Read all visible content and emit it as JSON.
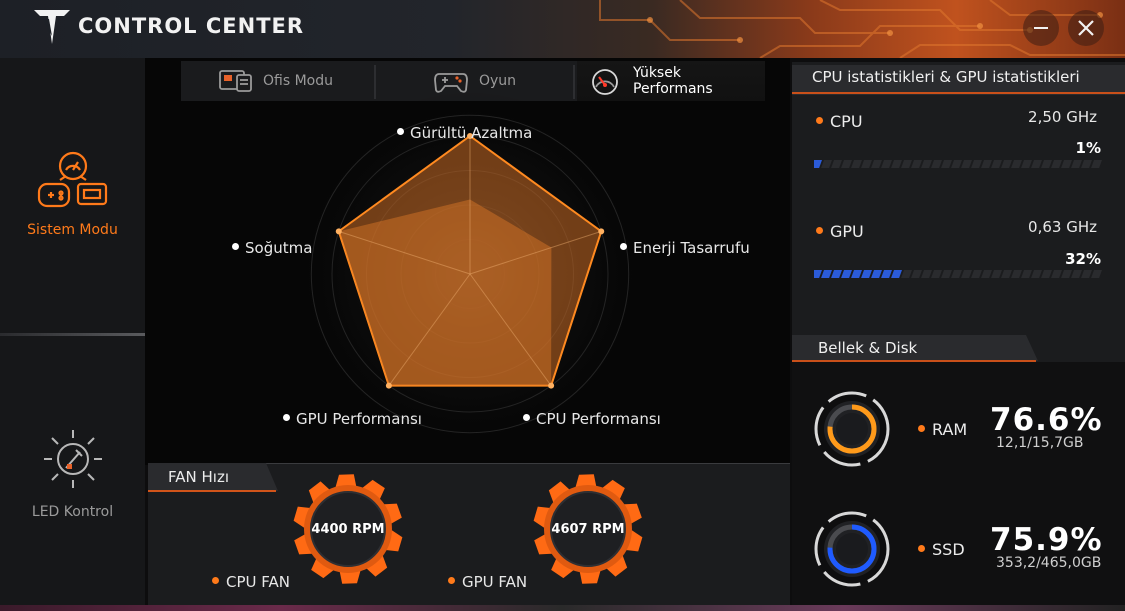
{
  "window": {
    "title": "CONTROL CENTER",
    "accent": "#ff7a1a"
  },
  "sidebar": {
    "items": [
      {
        "label": "Sistem Modu",
        "icon": "system-mode-icon",
        "active": true
      },
      {
        "label": "LED Kontrol",
        "icon": "led-control-icon",
        "active": false
      }
    ]
  },
  "modes": {
    "tabs": [
      {
        "label": "Ofis Modu",
        "icon": "office-icon",
        "active": false
      },
      {
        "label": "Oyun",
        "icon": "gamepad-icon",
        "active": false
      },
      {
        "label": "Yüksek Performans",
        "icon": "speedometer-icon",
        "active": true
      }
    ]
  },
  "radar": {
    "axes": [
      "Gürültü Azaltma",
      "Enerji Tasarrufu",
      "CPU Performansı",
      "GPU Performansı",
      "Soğutma"
    ],
    "profile_values": [
      1.0,
      1.0,
      1.0,
      1.0,
      1.0
    ],
    "inner_values": [
      0.54,
      0.62,
      1.0,
      1.0,
      1.0
    ]
  },
  "fans": {
    "title": "FAN Hızı",
    "items": [
      {
        "label": "CPU FAN",
        "rpm": "4400 RPM"
      },
      {
        "label": "GPU FAN",
        "rpm": "4607 RPM"
      }
    ]
  },
  "stats": {
    "title": "CPU istatistikleri & GPU istatistikleri",
    "cpu": {
      "name": "CPU",
      "freq": "2,50 GHz",
      "load": "1%",
      "level": 0.01,
      "color": "#2b5bd8"
    },
    "gpu": {
      "name": "GPU",
      "freq": "0,63 GHz",
      "load": "32%",
      "level": 0.32,
      "color": "#2b5bd8"
    }
  },
  "memory": {
    "title": "Bellek & Disk",
    "ram": {
      "name": "RAM",
      "percent": "76.6%",
      "usage": "12,1/15,7GB",
      "level": 0.766,
      "color": "#ff9a1a"
    },
    "ssd": {
      "name": "SSD",
      "percent": "75.9%",
      "usage": "353,2/465,0GB",
      "level": 0.759,
      "color": "#1f5bff"
    }
  }
}
